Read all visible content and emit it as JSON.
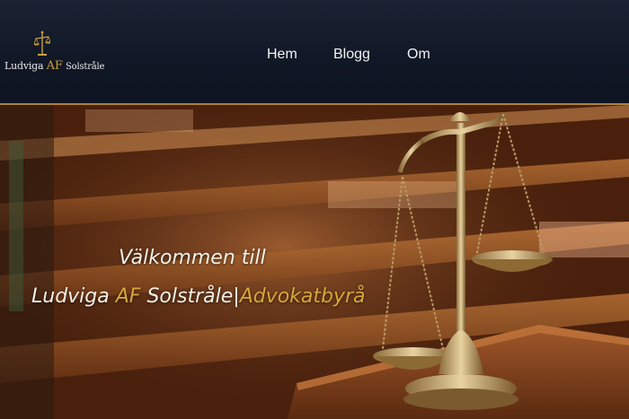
{
  "header": {
    "logo": {
      "icon": "scales-of-justice-icon",
      "name_first": "Ludviga",
      "name_mid": "AF",
      "name_last": "Solstråle"
    },
    "nav": [
      {
        "label": "Hem"
      },
      {
        "label": "Blogg"
      },
      {
        "label": "Om"
      }
    ]
  },
  "hero": {
    "line1": "Välkommen till",
    "line2_name": "Ludviga",
    "line2_af": "AF",
    "line2_surname": "Solstråle|",
    "line2_suffix": "Advokatbyrå",
    "background": "courtroom-with-scales-of-justice"
  },
  "colors": {
    "header_bg": "#111827",
    "accent_gold": "#c9a13b",
    "border": "#b0803c",
    "nav_text": "#f2f2f2"
  }
}
